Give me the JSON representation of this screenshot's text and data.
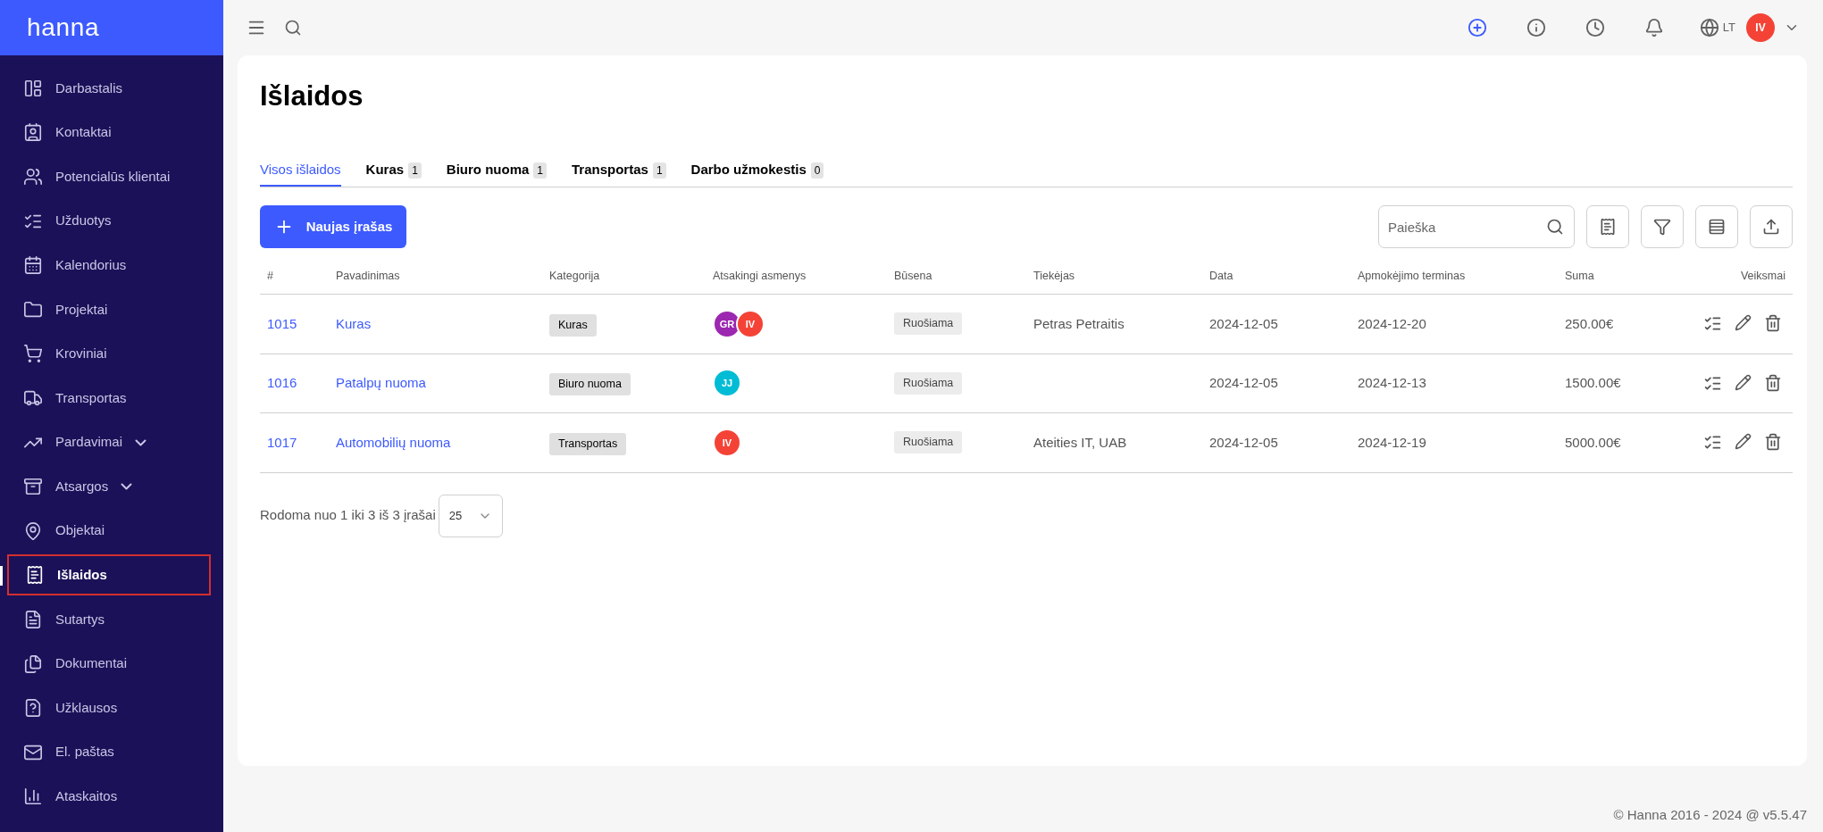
{
  "brand": "hanna",
  "sidebar": {
    "items": [
      {
        "label": "Darbastalis",
        "selected": false,
        "expandable": false
      },
      {
        "label": "Kontaktai",
        "selected": false,
        "expandable": false
      },
      {
        "label": "Potencialūs klientai",
        "selected": false,
        "expandable": false
      },
      {
        "label": "Užduotys",
        "selected": false,
        "expandable": false
      },
      {
        "label": "Kalendorius",
        "selected": false,
        "expandable": false
      },
      {
        "label": "Projektai",
        "selected": false,
        "expandable": false
      },
      {
        "label": "Kroviniai",
        "selected": false,
        "expandable": false
      },
      {
        "label": "Transportas",
        "selected": false,
        "expandable": false
      },
      {
        "label": "Pardavimai",
        "selected": false,
        "expandable": true
      },
      {
        "label": "Atsargos",
        "selected": false,
        "expandable": true
      },
      {
        "label": "Objektai",
        "selected": false,
        "expandable": false
      },
      {
        "label": "Išlaidos",
        "selected": true,
        "expandable": false
      },
      {
        "label": "Sutartys",
        "selected": false,
        "expandable": false
      },
      {
        "label": "Dokumentai",
        "selected": false,
        "expandable": false
      },
      {
        "label": "Užklausos",
        "selected": false,
        "expandable": false
      },
      {
        "label": "El. paštas",
        "selected": false,
        "expandable": false
      },
      {
        "label": "Ataskaitos",
        "selected": false,
        "expandable": false
      }
    ]
  },
  "header": {
    "language": "LT",
    "user_initials": "IV"
  },
  "page": {
    "title": "Išlaidos",
    "tabs": [
      {
        "label": "Visos išlaidos",
        "selected": true
      },
      {
        "label": "Kuras",
        "count": "1",
        "selected": false
      },
      {
        "label": "Biuro nuoma",
        "count": "1",
        "selected": false
      },
      {
        "label": "Transportas",
        "count": "1",
        "selected": false
      },
      {
        "label": "Darbo užmokestis",
        "count": "0",
        "selected": false
      }
    ],
    "new_button": "Naujas įrašas",
    "search": {
      "placeholder": "Paieška"
    },
    "table": {
      "columns": [
        "#",
        "Pavadinimas",
        "Kategorija",
        "Atsakingi asmenys",
        "Būsena",
        "Tiekėjas",
        "Data",
        "Apmokėjimo terminas",
        "Suma",
        "Veiksmai"
      ],
      "rows": [
        {
          "id": "1015",
          "name": "Kuras",
          "category": "Kuras",
          "people": [
            {
              "initials": "GR",
              "color": "#9c27b0"
            },
            {
              "initials": "IV",
              "color": "#f44336"
            }
          ],
          "status": "Ruošiama",
          "supplier": "Petras Petraitis",
          "date": "2024-12-05",
          "due": "2024-12-20",
          "sum": "250.00€"
        },
        {
          "id": "1016",
          "name": "Patalpų nuoma",
          "category": "Biuro nuoma",
          "people": [
            {
              "initials": "JJ",
              "color": "#00bcd4"
            }
          ],
          "status": "Ruošiama",
          "date": "2024-12-05",
          "due": "2024-12-13",
          "sum": "1500.00€"
        },
        {
          "id": "1017",
          "name": "Automobilių nuoma",
          "category": "Transportas",
          "people": [
            {
              "initials": "IV",
              "color": "#f44336"
            }
          ],
          "status": "Ruošiama",
          "supplier": "Ateities IT, UAB",
          "date": "2024-12-05",
          "due": "2024-12-19",
          "sum": "5000.00€"
        }
      ]
    },
    "pagination": {
      "summary": "Rodoma nuo 1 iki 3 iš 3 įrašai",
      "page_size": "25"
    }
  },
  "footer": "© Hanna 2016 - 2024 @ v5.5.47"
}
